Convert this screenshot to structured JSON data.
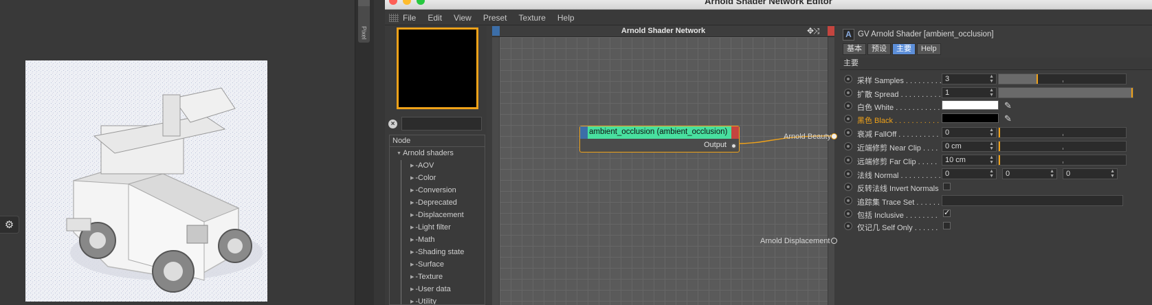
{
  "viewer": {
    "side_tab_label": "Pixel",
    "settings_icon": "gear-icon"
  },
  "editor": {
    "title": "Arnold Shader Network Editor",
    "menu": [
      "File",
      "Edit",
      "View",
      "Preset",
      "Texture",
      "Help"
    ],
    "search": {
      "value": "",
      "placeholder": ""
    },
    "node_tree": {
      "header": "Node",
      "root": "Arnold shaders",
      "children": [
        "-AOV",
        "-Color",
        "-Conversion",
        "-Deprecated",
        "-Displacement",
        "-Light filter",
        "-Math",
        "-Shading state",
        "-Surface",
        "-Texture",
        "-User data",
        "-Utility"
      ]
    }
  },
  "canvas": {
    "title": "Arnold Shader Network",
    "node": {
      "name": "ambient_occlusion (ambient_occlusion)",
      "output": "Output",
      "header_color": "#48e09f"
    },
    "ports": {
      "beauty": "Arnold Beauty",
      "displacement": "Arnold Displacement"
    },
    "connection_color": "#f0a219"
  },
  "attributes": {
    "title": "GV Arnold Shader [ambient_occlusion]",
    "tabs": [
      "基本",
      "预设",
      "主要",
      "Help"
    ],
    "active_tab": "主要",
    "section": "主要",
    "rows": {
      "samples": {
        "label": "采样 Samples . . . . . . . . . .",
        "value": "3",
        "slider_fill": 0.31
      },
      "spread": {
        "label": "扩散 Spread . . . . . . . . . . .",
        "value": "1",
        "slider_fill": 1.0
      },
      "white": {
        "label": "白色 White . . . . . . . . . . .",
        "color": "#ffffff"
      },
      "black": {
        "label": "黑色 Black . . . . . . . . . . .",
        "color": "#000000"
      },
      "falloff": {
        "label": "衰减 FallOff  . . . . . . . . . .",
        "value": "0",
        "slider_fill": 0.0
      },
      "near_clip": {
        "label": "近端修剪 Near Clip . . . .",
        "value": "0 cm",
        "slider_fill": 0.0
      },
      "far_clip": {
        "label": "远端修剪 Far Clip . . . . .",
        "value": "10 cm",
        "slider_fill": 0.0
      },
      "normal": {
        "label": "法线 Normal . . . . . . . . . .",
        "values": [
          "0",
          "0",
          "0"
        ]
      },
      "invert_normals": {
        "label": "反转法线 Invert Normals",
        "checked": false
      },
      "trace_set": {
        "label": "追踪集 Trace Set . . . . . .",
        "value": ""
      },
      "inclusive": {
        "label": "包括 Inclusive  . . . . . . . .",
        "checked": true
      },
      "self_only": {
        "label": "仅记几 Self Only  . . . . . .",
        "checked": false
      }
    },
    "accent_color": "#f0a219",
    "active_tab_color": "#5d8fd9"
  }
}
